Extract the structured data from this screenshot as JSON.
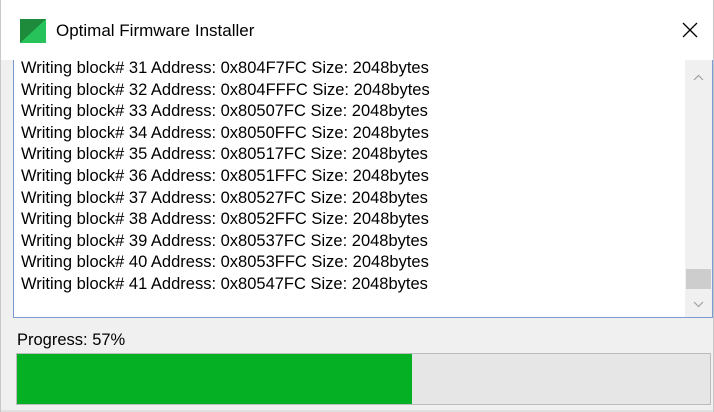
{
  "window": {
    "title": "Optimal Firmware Installer",
    "icon": "app-green-flag-icon",
    "close_icon": "close-icon"
  },
  "log": {
    "lines": [
      "Writing block# 31 Address: 0x804F7FC Size: 2048bytes",
      "Writing block# 32 Address: 0x804FFFC Size: 2048bytes",
      "Writing block# 33 Address: 0x80507FC Size: 2048bytes",
      "Writing block# 34 Address: 0x8050FFC Size: 2048bytes",
      "Writing block# 35 Address: 0x80517FC Size: 2048bytes",
      "Writing block# 36 Address: 0x8051FFC Size: 2048bytes",
      "Writing block# 37 Address: 0x80527FC Size: 2048bytes",
      "Writing block# 38 Address: 0x8052FFC Size: 2048bytes",
      "Writing block# 39 Address: 0x80537FC Size: 2048bytes",
      "Writing block# 40 Address: 0x8053FFC Size: 2048bytes",
      "Writing block# 41 Address: 0x80547FC Size: 2048bytes"
    ]
  },
  "progress": {
    "label": "Progress: 57%",
    "value": 0.57
  },
  "colors": {
    "progress_fill": "#06b025",
    "log_border": "#7a9bd0",
    "app_icon_dark": "#1e8a3c",
    "app_icon_light": "#27c25a"
  }
}
